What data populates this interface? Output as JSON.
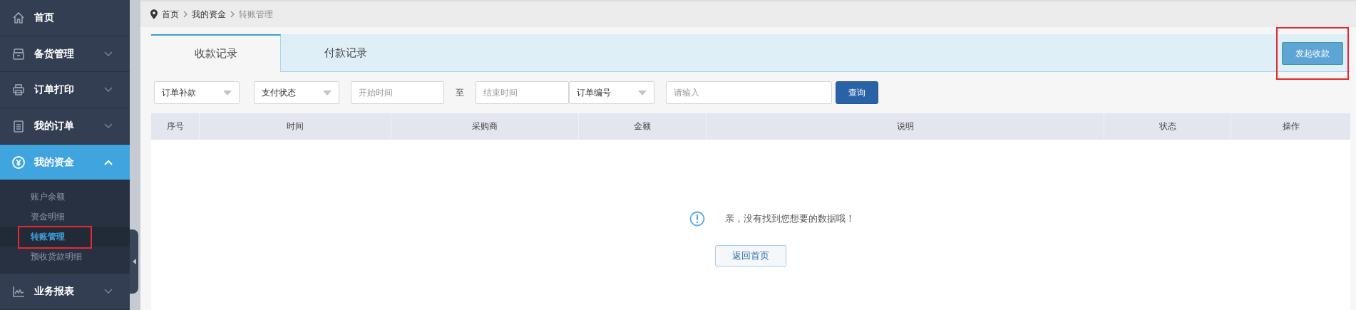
{
  "sidebar": {
    "items": [
      {
        "label": "首页",
        "kind": "link"
      },
      {
        "label": "备货管理",
        "kind": "menu",
        "expanded": false
      },
      {
        "label": "订单打印",
        "kind": "menu",
        "expanded": false
      },
      {
        "label": "我的订单",
        "kind": "menu",
        "expanded": false
      },
      {
        "label": "我的资金",
        "kind": "menu",
        "expanded": true,
        "children": [
          {
            "label": "账户余额",
            "selected": false,
            "highlighted": false
          },
          {
            "label": "资金明细",
            "selected": false,
            "highlighted": false
          },
          {
            "label": "转账管理",
            "selected": true,
            "highlighted": true
          },
          {
            "label": "预收货款明细",
            "selected": false,
            "highlighted": false
          }
        ]
      },
      {
        "label": "业务报表",
        "kind": "menu",
        "expanded": false
      }
    ]
  },
  "breadcrumb": [
    "首页",
    "我的资金",
    "转账管理"
  ],
  "tabs": [
    {
      "label": "收款记录",
      "selected": true
    },
    {
      "label": "付款记录",
      "selected": false
    }
  ],
  "action_button": {
    "label": "发起收款",
    "highlighted": true
  },
  "filters": [
    {
      "kind": "select",
      "value": "订单补款"
    },
    {
      "kind": "select",
      "value": "支付状态"
    },
    {
      "kind": "input",
      "placeholder": "开始时间"
    },
    {
      "kind": "text",
      "label": "至"
    },
    {
      "kind": "input",
      "placeholder": "结束时间"
    },
    {
      "kind": "select",
      "value": "订单编号"
    },
    {
      "kind": "search",
      "placeholder": "请输入"
    },
    {
      "kind": "button",
      "label": "查询"
    }
  ],
  "table": {
    "columns": [
      "序号",
      "时间",
      "采购商",
      "金额",
      "说明",
      "状态",
      "操作"
    ]
  },
  "empty_state": {
    "message": "亲，没有找到您想要的数据哦！",
    "button": "返回首页"
  }
}
